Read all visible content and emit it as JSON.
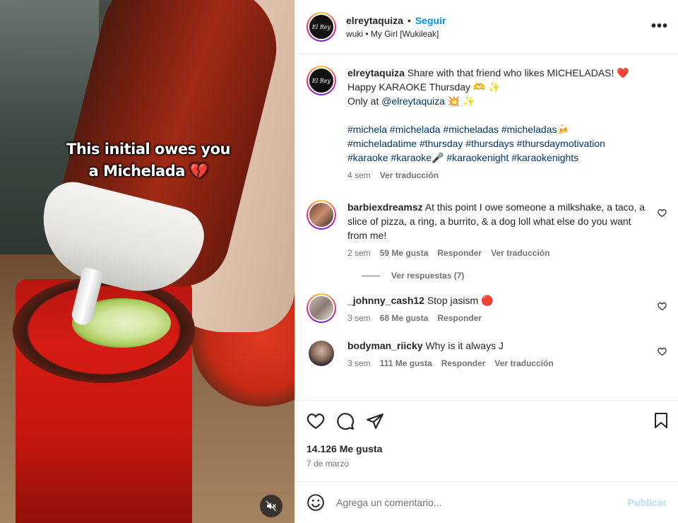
{
  "media": {
    "caption_line1": "This initial owes you",
    "caption_line2": "a Michelada 💔"
  },
  "header": {
    "username": "elreytaquiza",
    "follow_label": "Seguir",
    "separator": "•",
    "audio": "wuki • My Girl [Wukileak]",
    "more_icon": "•••"
  },
  "post": {
    "username": "elreytaquiza",
    "line1": "Share with that friend who likes MICHELADAS! ❤️",
    "line2": "Happy KARAOKE Thursday 🫶 ✨",
    "line3_prefix": "Only at ",
    "mention": "@elreytaquiza",
    "line3_suffix": " 💥 ✨",
    "hashtags_line1": "#michela #michelada #micheladas #micheladas🍻",
    "hashtags_line2": "#micheladatime #thursday #thursdays #thursdaymotivation",
    "hashtags_line3": "#karaoke #karaoke🎤 #karaokenight #karaokenights",
    "time": "4 sem",
    "translate": "Ver traducción"
  },
  "comments": [
    {
      "username": "barbiexdreamsz",
      "text": "At this point I owe someone a milkshake, a taco, a slice of pizza, a ring, a burrito, & a dog loll what else do you want from me!",
      "time": "2 sem",
      "likes": "59 Me gusta",
      "reply": "Responder",
      "translate": "Ver traducción"
    },
    {
      "username": "_johnny_cash12",
      "text": "Stop jasism 🔴",
      "time": "3 sem",
      "likes": "68 Me gusta",
      "reply": "Responder"
    },
    {
      "username": "bodyman_riicky",
      "text": "Why is it always J",
      "time": "3 sem",
      "likes": "111 Me gusta",
      "reply": "Responder",
      "translate": "Ver traducción"
    }
  ],
  "view_replies": "Ver respuestas (7)",
  "footer": {
    "likes": "14.126 Me gusta",
    "date": "7 de marzo",
    "comment_placeholder": "Agrega un comentario...",
    "publish": "Publicar"
  },
  "colors": {
    "accent": "#0095f6",
    "link": "#00376b",
    "muted": "#737373",
    "publish_disabled": "#b2dffc"
  },
  "icons": {
    "like": "heart-icon",
    "comment": "comment-icon",
    "share": "share-icon",
    "save": "bookmark-icon",
    "emoji": "emoji-icon",
    "mute": "muted-speaker-icon"
  }
}
